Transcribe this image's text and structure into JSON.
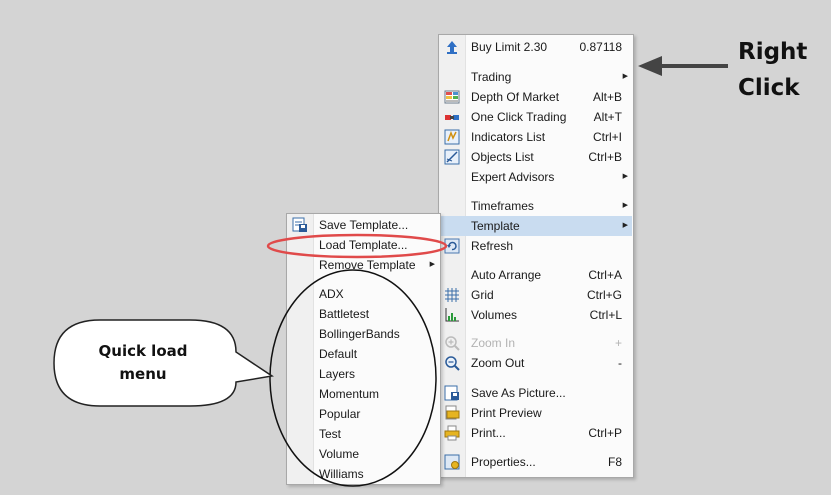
{
  "main_menu": {
    "items": [
      {
        "label": "Buy Limit 2.30",
        "shortcut": "0.87118",
        "icon": "buy-limit-arrow-icon"
      },
      {
        "label": "Trading",
        "submenu": true
      },
      {
        "label": "Depth Of Market",
        "shortcut": "Alt+B",
        "icon": "depth-of-market-icon"
      },
      {
        "label": "One Click Trading",
        "shortcut": "Alt+T",
        "icon": "one-click-trading-icon"
      },
      {
        "label": "Indicators List",
        "shortcut": "Ctrl+I",
        "icon": "indicators-list-icon"
      },
      {
        "label": "Objects List",
        "shortcut": "Ctrl+B",
        "icon": "objects-list-icon"
      },
      {
        "label": "Expert Advisors",
        "submenu": true
      },
      {
        "label": "Timeframes",
        "submenu": true
      },
      {
        "label": "Template",
        "submenu": true,
        "highlighted": true
      },
      {
        "label": "Refresh",
        "icon": "refresh-icon"
      },
      {
        "label": "Auto Arrange",
        "shortcut": "Ctrl+A"
      },
      {
        "label": "Grid",
        "shortcut": "Ctrl+G",
        "icon": "grid-icon"
      },
      {
        "label": "Volumes",
        "shortcut": "Ctrl+L",
        "icon": "volumes-icon"
      },
      {
        "label": "Zoom In",
        "shortcut": "+",
        "disabled": true,
        "icon": "zoom-in-icon"
      },
      {
        "label": "Zoom Out",
        "shortcut": "-",
        "icon": "zoom-out-icon"
      },
      {
        "label": "Save As Picture...",
        "icon": "save-picture-icon"
      },
      {
        "label": "Print Preview",
        "icon": "print-preview-icon"
      },
      {
        "label": "Print...",
        "shortcut": "Ctrl+P",
        "icon": "print-icon"
      },
      {
        "label": "Properties...",
        "shortcut": "F8",
        "icon": "properties-icon"
      }
    ]
  },
  "template_menu": {
    "items": [
      {
        "label": "Save Template...",
        "icon": "save-template-icon"
      },
      {
        "label": "Load Template..."
      },
      {
        "label": "Remove Template",
        "submenu": true
      },
      {
        "label": "ADX"
      },
      {
        "label": "Battletest"
      },
      {
        "label": "BollingerBands"
      },
      {
        "label": "Default"
      },
      {
        "label": "Layers"
      },
      {
        "label": "Momentum"
      },
      {
        "label": "Popular"
      },
      {
        "label": "Test"
      },
      {
        "label": "Volume"
      },
      {
        "label": "Williams"
      }
    ]
  },
  "annotations": {
    "right_click_line1": "Right",
    "right_click_line2": "Click",
    "quick_load_line1": "Quick load",
    "quick_load_line2": "menu"
  },
  "colors": {
    "highlight": "#c9dcf0",
    "annotation_red": "#e04a4a",
    "arrow": "#444444"
  }
}
